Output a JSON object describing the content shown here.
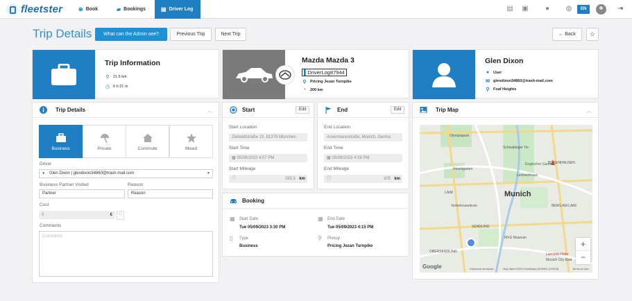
{
  "app": {
    "logo_text": "fleetster"
  },
  "nav": {
    "book": "Book",
    "bookings": "Bookings",
    "driver_log": "Driver Log"
  },
  "topbar": {
    "language": "EN"
  },
  "header": {
    "title": "Trip Details",
    "admin_button": "What can the Admin see?",
    "prev_button": "Previous Trip",
    "next_button": "Next Trip",
    "back_button": "Back"
  },
  "trip_info": {
    "title": "Trip Information",
    "distance": "21.5 km",
    "duration": "0 h 21 m"
  },
  "vehicle": {
    "title": "Mazda Mazda 3",
    "plate": "DriverLog87944",
    "location": "Pricing Jezan Turnpike",
    "range": "200 km"
  },
  "driver_card": {
    "name": "Glen Dixon",
    "role": "User",
    "email": "glendixon34860@trash-mail.com",
    "location": "Foaf Heights"
  },
  "trip_details": {
    "title": "Trip Details",
    "purposes": [
      {
        "label": "Business",
        "icon": "briefcase-icon"
      },
      {
        "label": "Private",
        "icon": "umbrella-icon"
      },
      {
        "label": "Commute",
        "icon": "home-icon"
      },
      {
        "label": "Mixed",
        "icon": "star-icon"
      }
    ],
    "driver_label": "Driver",
    "driver_value": "Glen Dixon | glendixon34860@trash-mail.com",
    "partner_label": "Business Partner Visited",
    "partner_value": "Partner",
    "reason_label": "Reason",
    "reason_value": "Reason",
    "cost_label": "Cost",
    "cost_value": "0",
    "currency": "€",
    "comments_label": "Comments",
    "comments_placeholder": "Comments"
  },
  "start": {
    "title": "Start",
    "edit": "Edit",
    "location_label": "Start Location",
    "location_value": "Zielstattstraße 15, 81379 München",
    "time_label": "Start Time",
    "time_value": "05/09/2023 4:07 PM",
    "mileage_label": "Start Mileage",
    "mileage_value": "283.5",
    "unit": "km"
  },
  "end": {
    "title": "End",
    "edit": "Edit",
    "location_label": "End Location",
    "location_value": "Ackermannstraße, Munich, Germa",
    "time_label": "End Time",
    "time_value": "05/09/2023 4:28 PM",
    "mileage_label": "End Mileage",
    "mileage_value": "305",
    "unit": "km"
  },
  "booking": {
    "title": "Booking",
    "start_label": "Start Date",
    "start_value": "Tue 05/09/2023 3:30 PM",
    "end_label": "End Date",
    "end_value": "Tue 05/09/2023 4:15 PM",
    "type_label": "Type",
    "type_value": "Business",
    "pickup_label": "Pickup",
    "pickup_value": "Pricing Jezan Turnpike"
  },
  "map": {
    "title": "Trip Map",
    "labels": {
      "olympiapark": "Olympiapark",
      "schwabinger": "Schwabinger Tor",
      "hirschgarten": "Hirschgarten",
      "englischer": "Englischer Garten",
      "bogenhausen": "BOGENHAUSEN",
      "laim": "LAIM",
      "munich": "Munich",
      "berg": "BERG AM LAIM",
      "verkehrs": "Verkehrszentrum",
      "sendling": "SENDLING",
      "obersendling": "OBERSENDLING",
      "mvg": "MVG Museum",
      "lenbach": "Lenbachhaus",
      "hofer": "Lancelot Hofer",
      "munich_city": "Munich City East"
    },
    "google": "Google",
    "shortcuts": "Keyboard shortcuts",
    "attribution": "Map data ©2023 GeoBasis-DE/BKG (©2009)",
    "terms": "Terms of Use",
    "zoom_in": "+",
    "zoom_out": "−"
  },
  "colors": {
    "accent": "#1f7fc2",
    "header_blue": "#3a8fd0",
    "vehicle_gray": "#7a7a7a"
  }
}
